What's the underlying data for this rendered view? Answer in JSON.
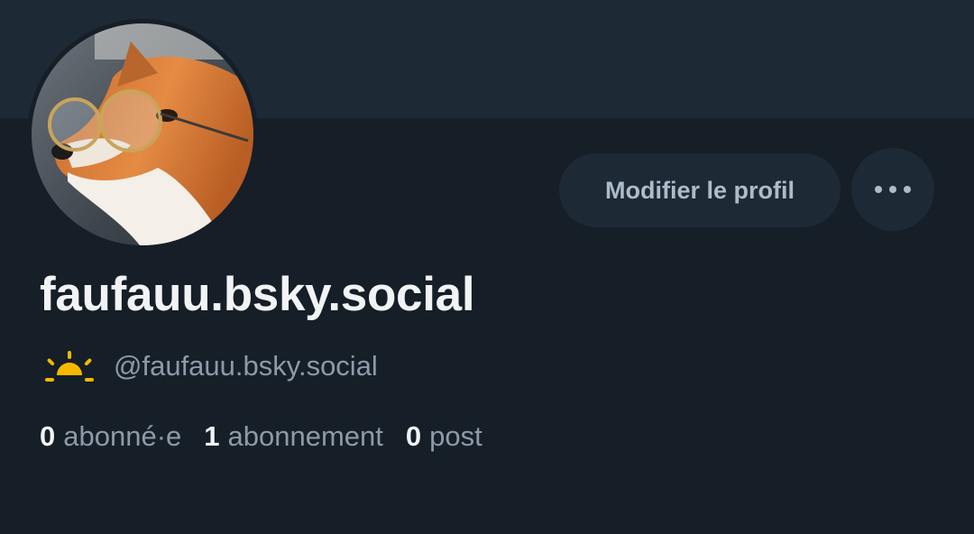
{
  "profile": {
    "display_name": "faufauu.bsky.social",
    "handle": "@faufauu.bsky.social",
    "avatar_subject": "fox wearing glasses",
    "status_icon": "sunrise-icon"
  },
  "actions": {
    "edit_label": "Modifier le profil",
    "more_icon": "ellipsis-icon"
  },
  "stats": [
    {
      "count": "0",
      "label": "abonné·e"
    },
    {
      "count": "1",
      "label": "abonnement"
    },
    {
      "count": "0",
      "label": "post"
    }
  ],
  "colors": {
    "background": "#161e27",
    "banner": "#1e2936",
    "button": "#1e2936",
    "primary_text": "#f1f3f5",
    "secondary_text": "#8d9aa9",
    "status_icon": "#f5b800"
  }
}
